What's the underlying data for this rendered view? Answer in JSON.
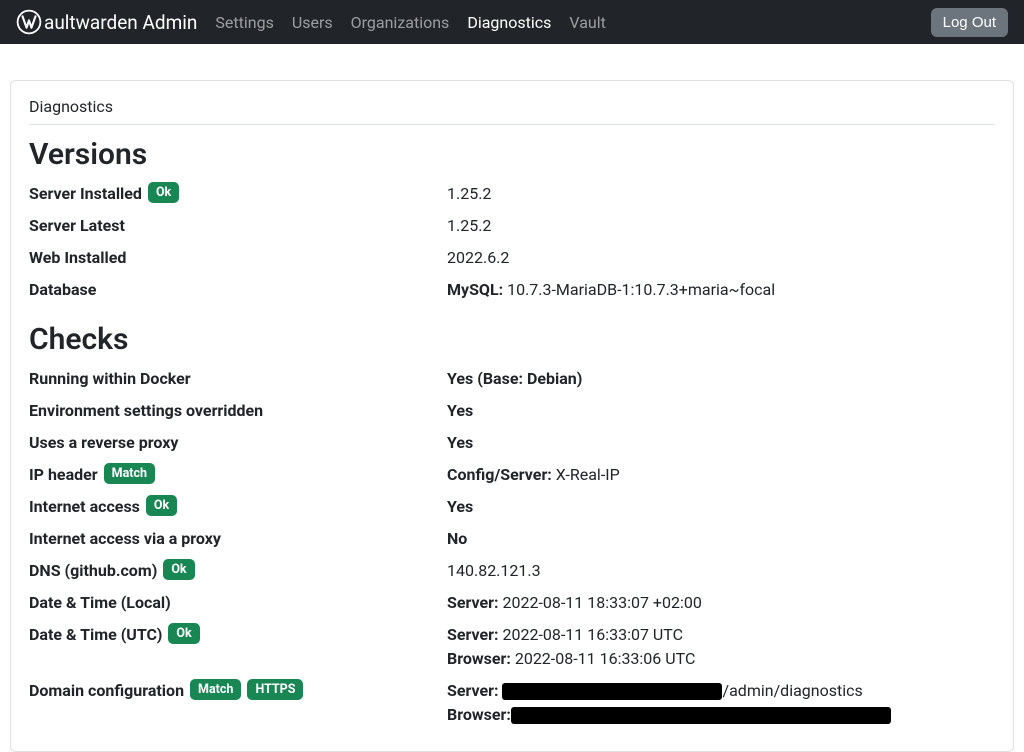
{
  "navbar": {
    "brand": "aultwarden Admin",
    "links": [
      "Settings",
      "Users",
      "Organizations",
      "Diagnostics",
      "Vault"
    ],
    "active": "Diagnostics",
    "logout": "Log Out"
  },
  "card_title": "Diagnostics",
  "sections": {
    "versions": {
      "heading": "Versions",
      "rows": [
        {
          "label": "Server Installed",
          "badges": [
            "Ok"
          ],
          "value_html": [
            {
              "t": "plain",
              "v": "1.25.2"
            }
          ]
        },
        {
          "label": "Server Latest",
          "badges": [],
          "value_html": [
            {
              "t": "plain",
              "v": "1.25.2"
            }
          ]
        },
        {
          "label": "Web Installed",
          "badges": [],
          "value_html": [
            {
              "t": "plain",
              "v": "2022.6.2"
            }
          ]
        },
        {
          "label": "Database",
          "badges": [],
          "value_html": [
            {
              "t": "bold",
              "v": "MySQL: "
            },
            {
              "t": "plain",
              "v": "10.7.3-MariaDB-1:10.7.3+maria~focal"
            }
          ]
        }
      ]
    },
    "checks": {
      "heading": "Checks",
      "rows": [
        {
          "label": "Running within Docker",
          "badges": [],
          "value_html": [
            {
              "t": "bold",
              "v": "Yes (Base: Debian)"
            }
          ]
        },
        {
          "label": "Environment settings overridden",
          "badges": [],
          "value_html": [
            {
              "t": "bold",
              "v": "Yes"
            }
          ]
        },
        {
          "label": "Uses a reverse proxy",
          "badges": [],
          "value_html": [
            {
              "t": "bold",
              "v": "Yes"
            }
          ]
        },
        {
          "label": "IP header",
          "badges": [
            "Match"
          ],
          "value_html": [
            {
              "t": "bold",
              "v": "Config/Server: "
            },
            {
              "t": "plain",
              "v": "X-Real-IP"
            }
          ]
        },
        {
          "label": "Internet access",
          "badges": [
            "Ok"
          ],
          "value_html": [
            {
              "t": "bold",
              "v": "Yes"
            }
          ]
        },
        {
          "label": "Internet access via a proxy",
          "badges": [],
          "value_html": [
            {
              "t": "bold",
              "v": "No"
            }
          ]
        },
        {
          "label": "DNS (github.com)",
          "badges": [
            "Ok"
          ],
          "value_html": [
            {
              "t": "plain",
              "v": "140.82.121.3"
            }
          ]
        },
        {
          "label": "Date & Time (Local)",
          "badges": [],
          "value_html": [
            {
              "t": "bold",
              "v": "Server: "
            },
            {
              "t": "plain",
              "v": "2022-08-11 18:33:07 +02:00"
            }
          ]
        },
        {
          "label": "Date & Time (UTC)",
          "badges": [
            "Ok"
          ],
          "value_html": [
            {
              "t": "bold",
              "v": "Server: "
            },
            {
              "t": "plain",
              "v": "2022-08-11 16:33:07 UTC"
            },
            {
              "t": "br"
            },
            {
              "t": "bold",
              "v": "Browser: "
            },
            {
              "t": "plain",
              "v": "2022-08-11 16:33:06 UTC"
            }
          ]
        },
        {
          "label": "Domain configuration",
          "badges": [
            "Match",
            "HTTPS"
          ],
          "value_html": [
            {
              "t": "bold",
              "v": "Server: "
            },
            {
              "t": "redact",
              "w": "w1"
            },
            {
              "t": "plain",
              "v": "/admin/diagnostics"
            },
            {
              "t": "br"
            },
            {
              "t": "bold",
              "v": "Browser:"
            },
            {
              "t": "redact",
              "w": "w2"
            }
          ]
        }
      ]
    }
  }
}
